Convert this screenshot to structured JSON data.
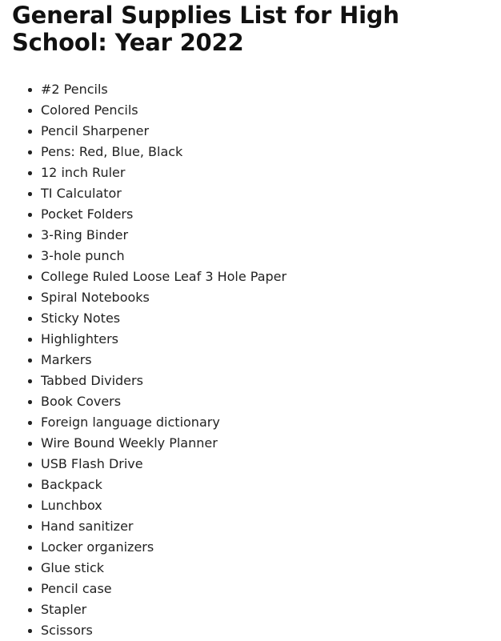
{
  "document": {
    "title": "General Supplies List for High School: Year 2022",
    "bullet_glyph": "•",
    "text_color": "#222222",
    "title_color": "#111111",
    "background_color": "#ffffff"
  },
  "supplies": [
    "#2 Pencils",
    "Colored Pencils",
    "Pencil Sharpener",
    "Pens: Red, Blue, Black",
    "12 inch Ruler",
    "TI Calculator",
    "Pocket Folders",
    "3-Ring Binder",
    "3-hole punch",
    "College Ruled Loose Leaf 3 Hole Paper",
    "Spiral Notebooks",
    "Sticky Notes",
    "Highlighters",
    "Markers",
    "Tabbed Dividers",
    "Book Covers",
    "Foreign language dictionary",
    "Wire Bound Weekly Planner",
    "USB Flash Drive",
    "Backpack",
    "Lunchbox",
    "Hand sanitizer",
    "Locker organizers",
    "Glue stick",
    "Pencil case",
    "Stapler",
    "Scissors"
  ]
}
